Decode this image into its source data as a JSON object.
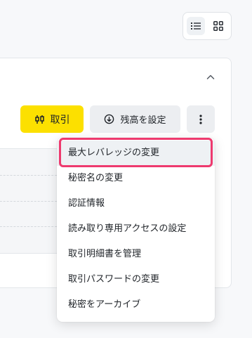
{
  "view_toggle": {
    "list_icon": "list-icon",
    "grid_icon": "grid-icon"
  },
  "actions": {
    "trade_label": "取引",
    "trade_icon": "candlestick-icon",
    "balance_label": "残高を設定",
    "balance_icon": "arrow-down-circle-icon",
    "more_icon": "vertical-dots-icon"
  },
  "menu": {
    "items": [
      "最大レバレッジの変更",
      "秘密名の変更",
      "認証情報",
      "読み取り専用アクセスの設定",
      "取引明細書を管理",
      "取引パスワードの変更",
      "秘密をアーカイブ"
    ],
    "highlighted_index": 0
  },
  "colors": {
    "trade_button": "#fce000",
    "highlight_ring": "#ee3a6e"
  }
}
